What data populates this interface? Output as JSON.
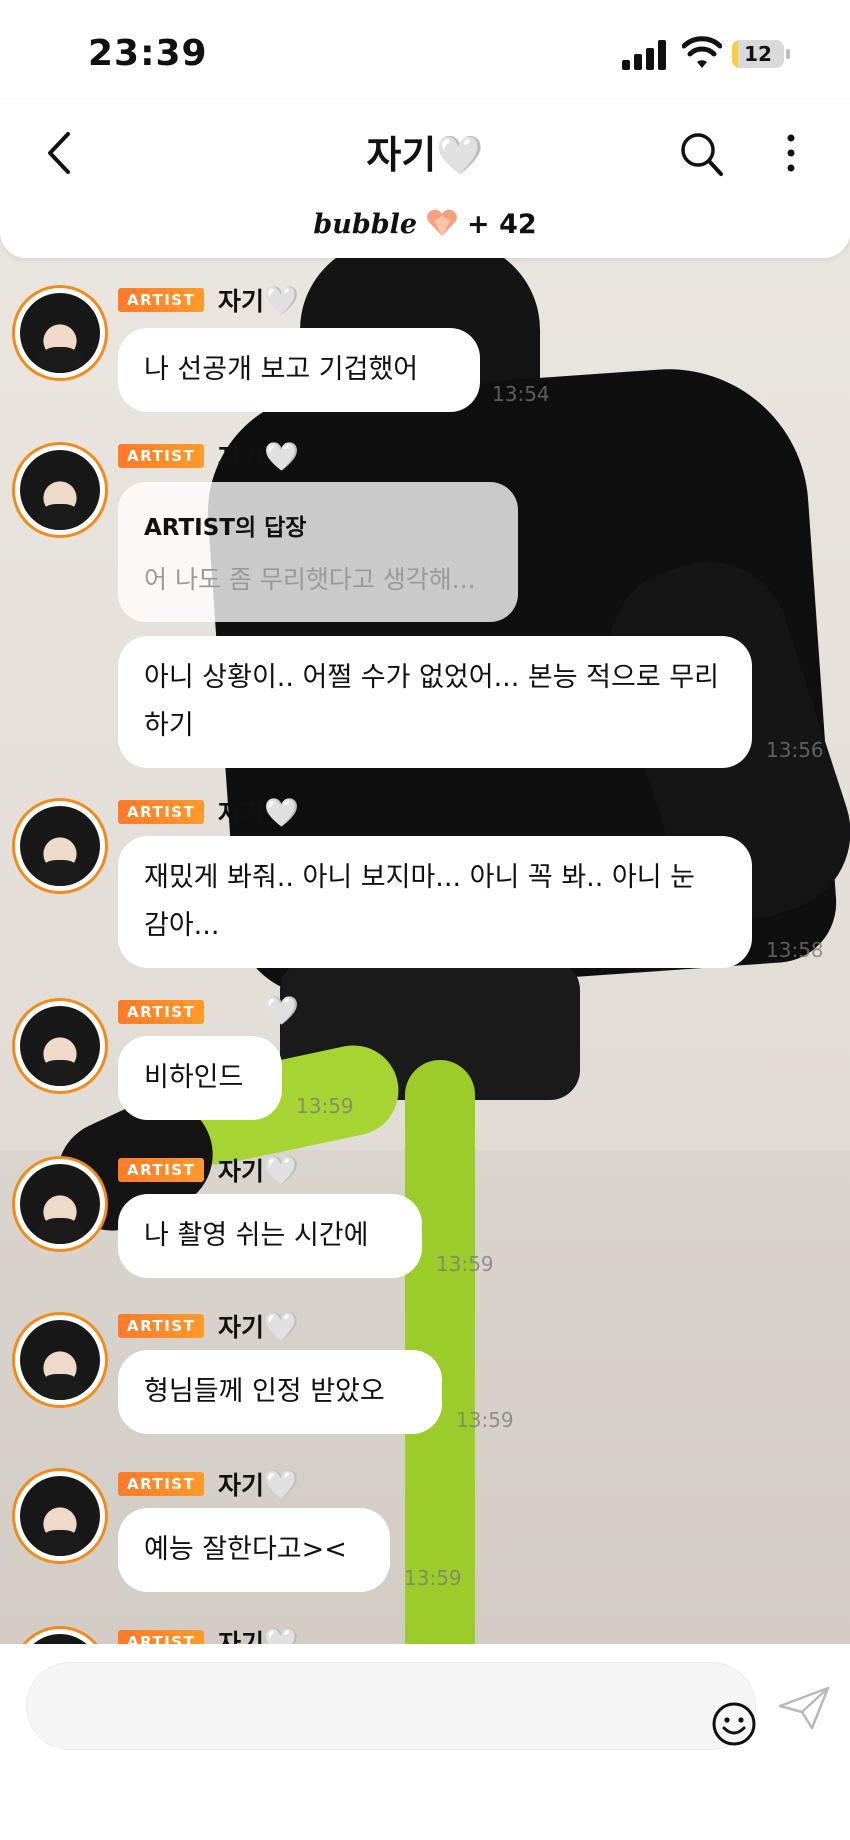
{
  "status_bar": {
    "time": "23:39",
    "battery": "12",
    "battery_level": 0.12
  },
  "header": {
    "title": "자기🤍",
    "bubble_logo": "bubble",
    "bubble_count": "+ 42"
  },
  "messages": [
    {
      "badge": "ARTIST",
      "nick": "자기",
      "heart": "🤍",
      "text": "나 선공개 보고 기겁했어",
      "time": "13:54"
    },
    {
      "badge": "ARTIST",
      "nick": "자기",
      "heart": "🤍",
      "reply_title": "ARTIST의 답장",
      "reply_body": "어 나도 좀 무리햇다고 생각해...",
      "text": "아니 상황이.. 어쩔 수가 없었어... 본능 적으로 무리하기",
      "time": "13:56"
    },
    {
      "badge": "ARTIST",
      "nick": "자기",
      "heart": "🤍",
      "text": "재밌게 봐줘.. 아니 보지마... 아니 꼭 봐.. 아니 눈 감아...",
      "time": "13:58"
    },
    {
      "badge": "ARTIST",
      "nick": "",
      "heart": "🤍",
      "text": "비하인드",
      "time": "13:59"
    },
    {
      "badge": "ARTIST",
      "nick": "자기",
      "heart": "🤍",
      "text": "나 촬영 쉬는 시간에",
      "time": "13:59"
    },
    {
      "badge": "ARTIST",
      "nick": "자기",
      "heart": "🤍",
      "text": "형님들께 인정 받았오",
      "time": "13:59"
    },
    {
      "badge": "ARTIST",
      "nick": "자기",
      "heart": "🤍",
      "text": "예능 잘한다고><",
      "time": "13:59"
    },
    {
      "badge": "ARTIST",
      "nick": "자기",
      "heart": "🤍"
    }
  ],
  "colors": {
    "accent": "#ff7a2a",
    "avatar_ring": "#f28a1c"
  },
  "icons": [
    "back-icon",
    "search-icon",
    "more-icon",
    "gem-heart-icon",
    "emoji-icon",
    "send-icon"
  ]
}
